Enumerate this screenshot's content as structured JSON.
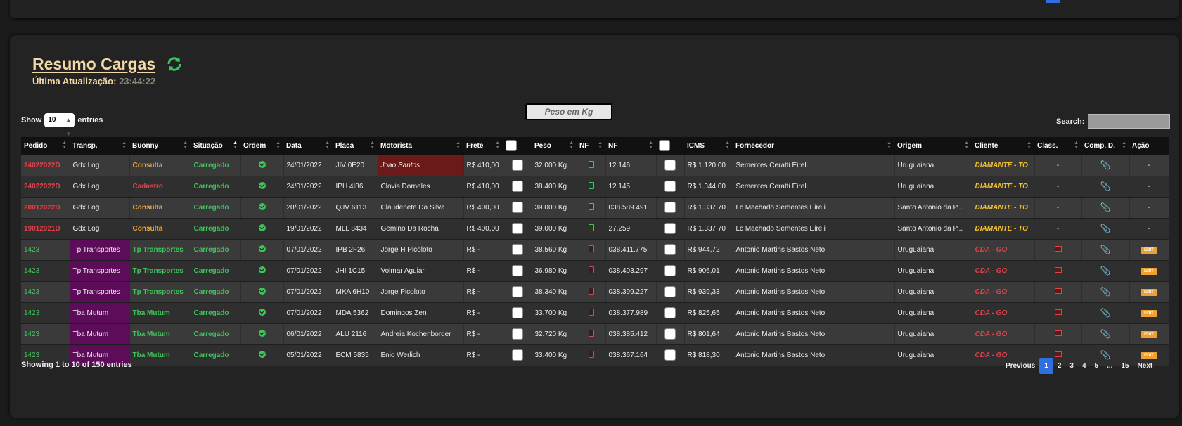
{
  "title": "Resumo Cargas",
  "last_update_label": "Última Atualização:",
  "last_update_time": "23:44:22",
  "peso_button": "Peso em Kg",
  "show_label": "Show",
  "show_value": "10",
  "entries_label": "entries",
  "search_label": "Search:",
  "columns": [
    "Pedido",
    "Transp.",
    "Buonny",
    "Situação",
    "Ordem",
    "Data",
    "Placa",
    "Motorista",
    "Frete",
    "",
    "Peso",
    "NF",
    "NF",
    "",
    "ICMS",
    "Fornecedor",
    "Origem",
    "Cliente",
    "Class.",
    "Comp. D.",
    "Ação"
  ],
  "rows": [
    {
      "pedido": "24022022D",
      "transp": "Gdx Log",
      "buonny": "Consulta",
      "situacao": "Carregado",
      "data": "24/01/2022",
      "placa": "JIV 0E20",
      "motorista": "Joao Santos",
      "frete": "R$ 410,00",
      "peso": "32.000 Kg",
      "nf": "12.146",
      "icms": "R$ 1.120,00",
      "fornecedor": "Sementes Ceratti Eireli",
      "origem": "Uruguaiana",
      "cliente": "DIAMANTE - TO",
      "class": "-",
      "acao": "-"
    },
    {
      "pedido": "24022022D",
      "transp": "Gdx Log",
      "buonny": "Cadastro",
      "situacao": "Carregado",
      "data": "24/01/2022",
      "placa": "IPH 4I86",
      "motorista": "Clovis Dorneles",
      "frete": "R$ 410,00",
      "peso": "38.400 Kg",
      "nf": "12.145",
      "icms": "R$ 1.344,00",
      "fornecedor": "Sementes Ceratti Eireli",
      "origem": "Uruguaiana",
      "cliente": "DIAMANTE - TO",
      "class": "-",
      "acao": "-"
    },
    {
      "pedido": "20012022D",
      "transp": "Gdx Log",
      "buonny": "Consulta",
      "situacao": "Carregado",
      "data": "20/01/2022",
      "placa": "QJV 6113",
      "motorista": "Claudenete Da Silva",
      "frete": "R$ 400,00",
      "peso": "39.000 Kg",
      "nf": "038.589.491",
      "icms": "R$ 1.337,70",
      "fornecedor": "Lc Machado Sementes Eireli",
      "origem": "Santo Antonio da P...",
      "cliente": "DIAMANTE - TO",
      "class": "-",
      "acao": "-"
    },
    {
      "pedido": "19012021D",
      "transp": "Gdx Log",
      "buonny": "Consulta",
      "situacao": "Carregado",
      "data": "19/01/2022",
      "placa": "MLL 8434",
      "motorista": "Gemino Da Rocha",
      "frete": "R$ 400,00",
      "peso": "39.000 Kg",
      "nf": "27.259",
      "icms": "R$ 1.337,70",
      "fornecedor": "Lc Machado Sementes Eireli",
      "origem": "Santo Antonio da P...",
      "cliente": "DIAMANTE - TO",
      "class": "-",
      "acao": "-"
    },
    {
      "pedido": "1423",
      "transp": "Tp Transportes",
      "buonny": "Tp Transportes",
      "situacao": "Carregado",
      "data": "07/01/2022",
      "placa": "IPB 2F26",
      "motorista": "Jorge H Picoloto",
      "frete": "R$    -",
      "peso": "38.560 Kg",
      "nf": "038.411.775",
      "icms": "R$ 944,72",
      "fornecedor": "Antonio Martins Bastos Neto",
      "origem": "Uruguaiana",
      "cliente": "CDA - GO",
      "class": "",
      "acao": "EDIT"
    },
    {
      "pedido": "1423",
      "transp": "Tp Transportes",
      "buonny": "Tp Transportes",
      "situacao": "Carregado",
      "data": "07/01/2022",
      "placa": "JHI 1C15",
      "motorista": "Volmar Aguiar",
      "frete": "R$    -",
      "peso": "36.980 Kg",
      "nf": "038.403.297",
      "icms": "R$ 906,01",
      "fornecedor": "Antonio Martins Bastos Neto",
      "origem": "Uruguaiana",
      "cliente": "CDA - GO",
      "class": "",
      "acao": "EDIT"
    },
    {
      "pedido": "1423",
      "transp": "Tp Transportes",
      "buonny": "Tp Transportes",
      "situacao": "Carregado",
      "data": "07/01/2022",
      "placa": "MKA 6H10",
      "motorista": "Jorge Picoloto",
      "frete": "R$    -",
      "peso": "38.340 Kg",
      "nf": "038.399.227",
      "icms": "R$ 939,33",
      "fornecedor": "Antonio Martins Bastos Neto",
      "origem": "Uruguaiana",
      "cliente": "CDA - GO",
      "class": "",
      "acao": "EDIT"
    },
    {
      "pedido": "1423",
      "transp": "Tba Mutum",
      "buonny": "Tba Mutum",
      "situacao": "Carregado",
      "data": "07/01/2022",
      "placa": "MDA 5362",
      "motorista": "Domingos Zen",
      "frete": "R$    -",
      "peso": "33.700 Kg",
      "nf": "038.377.989",
      "icms": "R$ 825,65",
      "fornecedor": "Antonio Martins Bastos Neto",
      "origem": "Uruguaiana",
      "cliente": "CDA - GO",
      "class": "",
      "acao": "EDIT"
    },
    {
      "pedido": "1423",
      "transp": "Tba Mutum",
      "buonny": "Tba Mutum",
      "situacao": "Carregado",
      "data": "06/01/2022",
      "placa": "ALU 2116",
      "motorista": "Andreia Kochenborger",
      "frete": "R$    -",
      "peso": "32.720 Kg",
      "nf": "038.385.412",
      "icms": "R$ 801,64",
      "fornecedor": "Antonio Martins Bastos Neto",
      "origem": "Uruguaiana",
      "cliente": "CDA - GO",
      "class": "",
      "acao": "EDIT"
    },
    {
      "pedido": "1423",
      "transp": "Tba Mutum",
      "buonny": "Tba Mutum",
      "situacao": "Carregado",
      "data": "05/01/2022",
      "placa": "ECM 5835",
      "motorista": "Enio Werlich",
      "frete": "R$    -",
      "peso": "33.400 Kg",
      "nf": "038.367.164",
      "icms": "R$ 818,30",
      "fornecedor": "Antonio Martins Bastos Neto",
      "origem": "Uruguaiana",
      "cliente": "CDA - GO",
      "class": "",
      "acao": "EDIT"
    }
  ],
  "footer_info": "Showing 1 to 10 of 150 entries",
  "pagination": [
    "Previous",
    "1",
    "2",
    "3",
    "4",
    "5",
    "...",
    "15",
    "Next"
  ],
  "colors": {
    "accent_blue": "#2f6fdf",
    "title": "#f4d9a8",
    "green": "#3fc35b",
    "red": "#e0424b",
    "orange": "#e8a23a",
    "purple": "#5d0c59"
  }
}
